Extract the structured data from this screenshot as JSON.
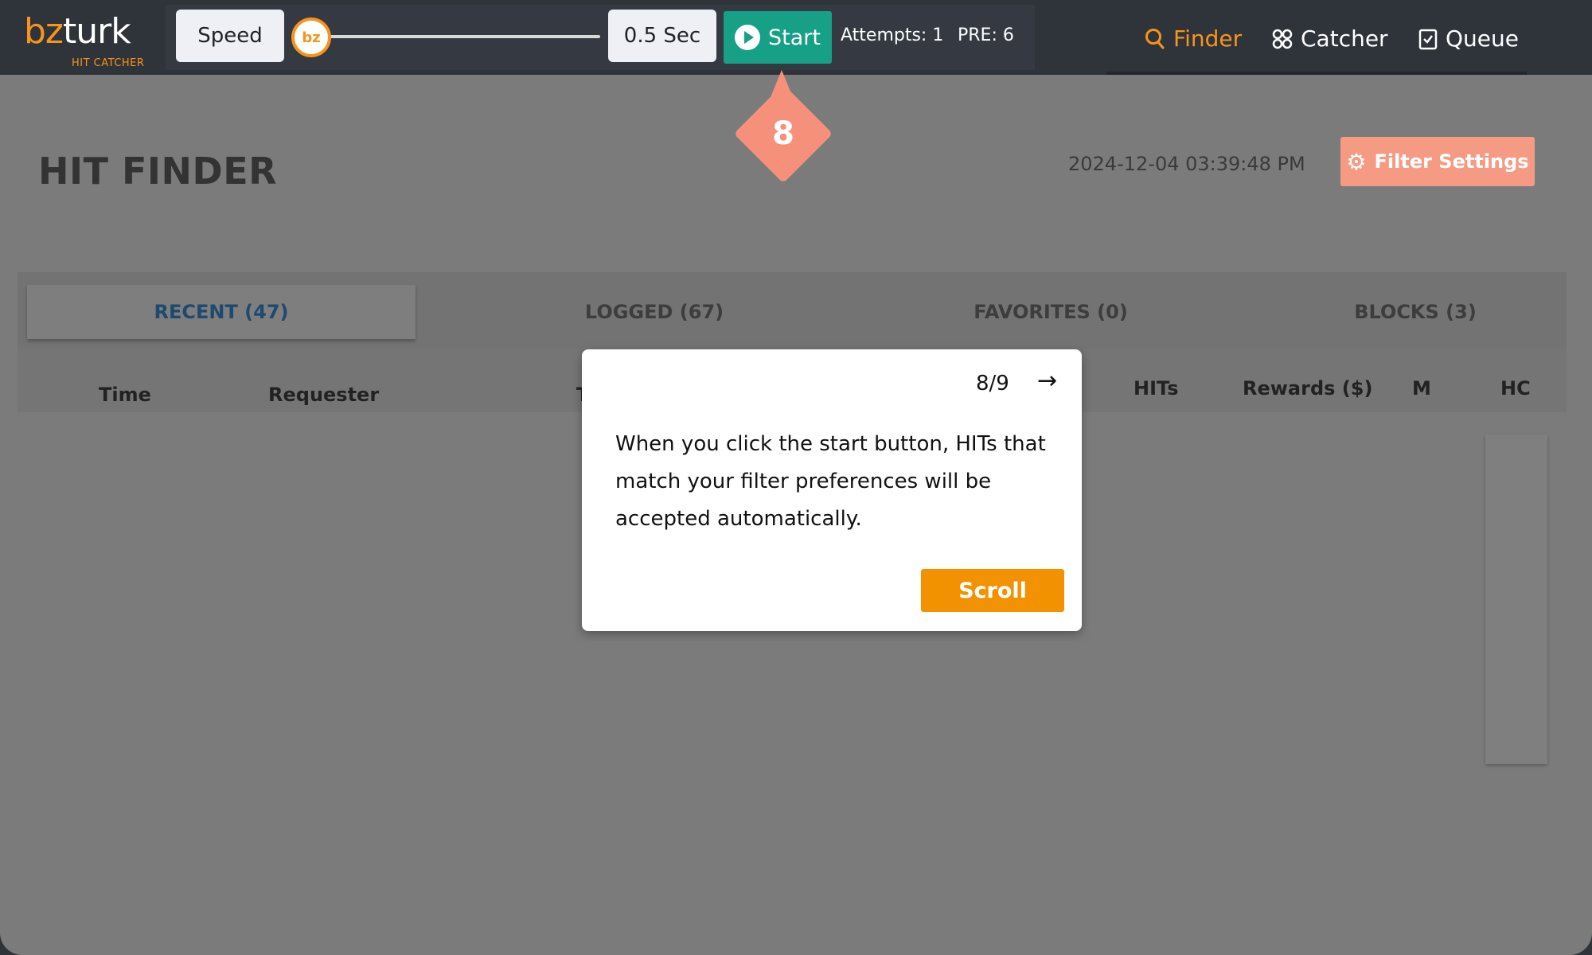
{
  "logo": {
    "brand_bz": "bz",
    "brand_turk": "turk",
    "subtitle": "HIT CATCHER"
  },
  "toolbar": {
    "speed_label": "Speed",
    "slider_thumb_text": "bz",
    "interval_label": "0.5 Sec",
    "start_label": "Start",
    "attempts": "Attempts: 1",
    "pre": "PRE: 6"
  },
  "nav": [
    {
      "label": "Finder",
      "icon": "search-icon",
      "active": true
    },
    {
      "label": "Catcher",
      "icon": "grid-icon",
      "active": false
    },
    {
      "label": "Queue",
      "icon": "checklist-icon",
      "active": false
    }
  ],
  "page": {
    "title": "HIT FINDER",
    "timestamp": "2024-12-04 03:39:48 PM",
    "filter_button": "Filter Settings"
  },
  "tabs": [
    {
      "label": "RECENT (47)",
      "active": true
    },
    {
      "label": "LOGGED (67)",
      "active": false
    },
    {
      "label": "FAVORITES (0)",
      "active": false
    },
    {
      "label": "BLOCKS (3)",
      "active": false
    }
  ],
  "columns": [
    "Time",
    "Requester",
    "T",
    "HITs",
    "Rewards ($)",
    "M",
    "HC"
  ],
  "tour": {
    "marker": "8",
    "step": "8/9",
    "arrow": "→",
    "text": "When you click the start button, HITs that match your filter preferences will be accepted automatically.",
    "button": "Scroll"
  },
  "colors": {
    "brand_orange": "#f7941d",
    "start_green": "#16a085",
    "filter_salmon": "#f59b83",
    "scroll_orange": "#f39200"
  }
}
